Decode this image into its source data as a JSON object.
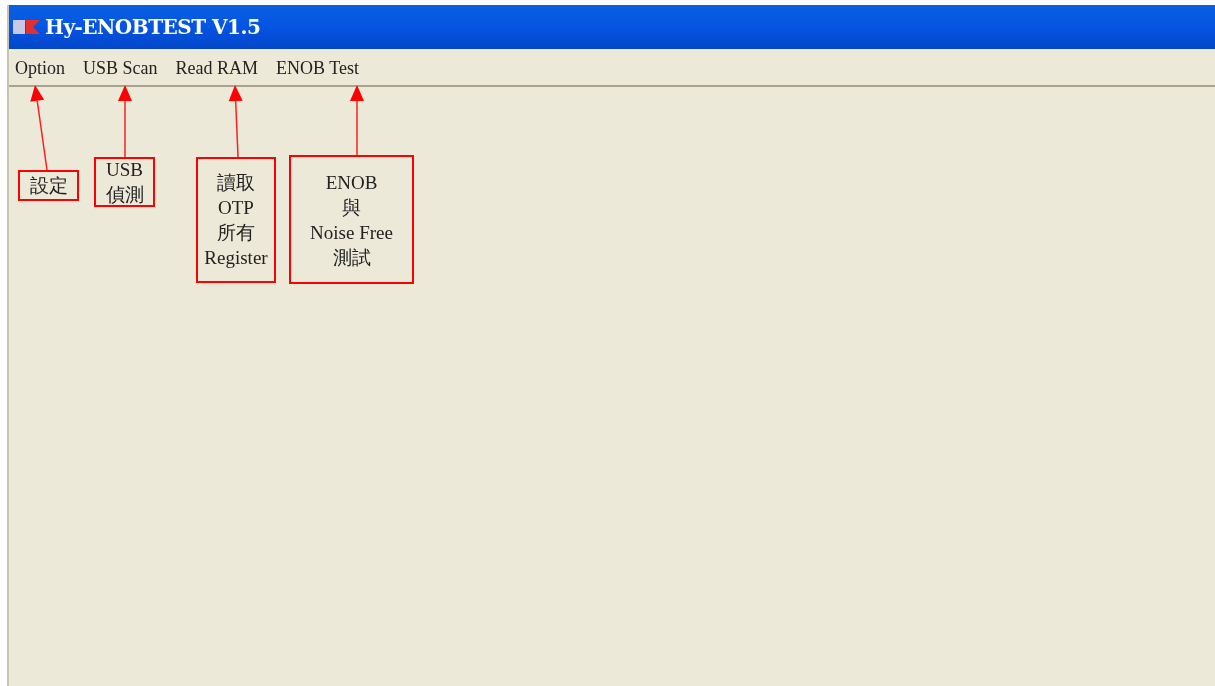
{
  "window": {
    "title": "Hy-ENOBTEST V1.5"
  },
  "menu": [
    {
      "label": "Option"
    },
    {
      "label": "USB Scan"
    },
    {
      "label": "Read RAM"
    },
    {
      "label": "ENOB Test"
    }
  ],
  "annotations": [
    {
      "text": "設定"
    },
    {
      "text": "USB\n偵測"
    },
    {
      "text": "讀取\nOTP\n所有\nRegister"
    },
    {
      "text": "ENOB\n與\nNoise Free\n測試"
    }
  ]
}
